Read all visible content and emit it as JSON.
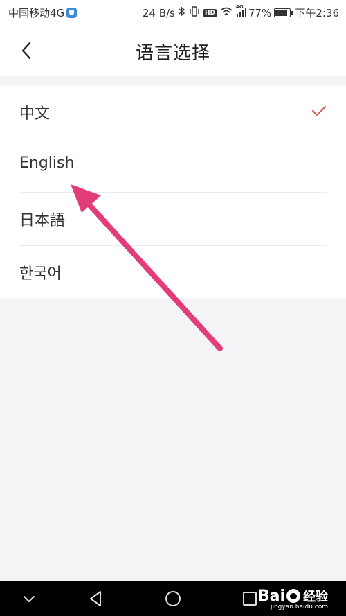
{
  "status_bar": {
    "carrier": "中国移动4G",
    "network_speed": "24 B/s",
    "hd_label": "HD",
    "signal_label": "4G",
    "battery": "77%",
    "time": "下午2:36"
  },
  "header": {
    "title": "语言选择"
  },
  "languages": [
    {
      "label": "中文",
      "selected": true
    },
    {
      "label": "English",
      "selected": false
    },
    {
      "label": "日本語",
      "selected": false
    },
    {
      "label": "한국어",
      "selected": false
    }
  ],
  "colors": {
    "check": "#e05a5a",
    "annotation_arrow": "#e23c7a",
    "background": "#f4f4f6"
  },
  "watermark": {
    "brand_left": "Bai",
    "brand_right": "经验",
    "url": "jingyan.baidu.com"
  }
}
